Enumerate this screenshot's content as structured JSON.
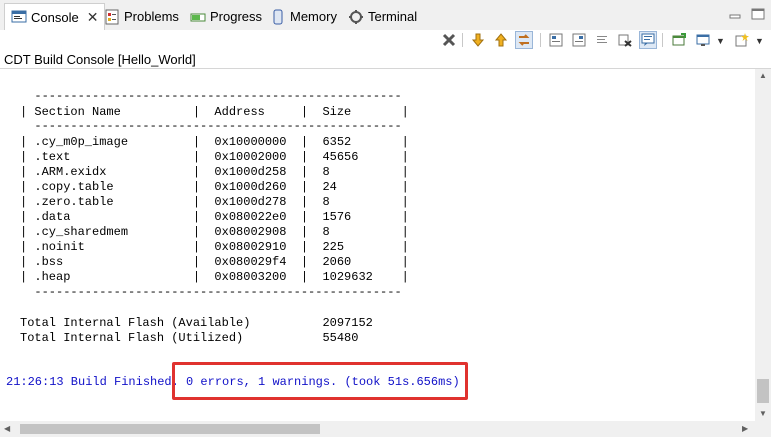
{
  "tabs": [
    {
      "label": "Console",
      "active": true,
      "icon": "console-icon"
    },
    {
      "label": "Problems",
      "active": false,
      "icon": "problems-icon"
    },
    {
      "label": "Progress",
      "active": false,
      "icon": "progress-icon"
    },
    {
      "label": "Memory",
      "active": false,
      "icon": "memory-icon"
    },
    {
      "label": "Terminal",
      "active": false,
      "icon": "terminal-icon"
    }
  ],
  "close_glyph": "✕",
  "console_title": "CDT Build Console [Hello_World]",
  "table": {
    "rule": "  ---------------------------------------------------",
    "header": "| Section Name          |  Address     |  Size       |",
    "rows": [
      "| .cy_m0p_image         |  0x10000000  |  6352       |",
      "| .text                 |  0x10002000  |  45656      |",
      "| .ARM.exidx            |  0x1000d258  |  8          |",
      "| .copy.table           |  0x1000d260  |  24         |",
      "| .zero.table           |  0x1000d278  |  8          |",
      "| .data                 |  0x080022e0  |  1576       |",
      "| .cy_sharedmem         |  0x08002908  |  8          |",
      "| .noinit               |  0x08002910  |  225        |",
      "| .bss                  |  0x080029f4  |  2060       |",
      "| .heap                 |  0x08003200  |  1029632    |"
    ]
  },
  "totals": [
    "Total Internal Flash (Available)          2097152",
    "Total Internal Flash (Utilized)           55480"
  ],
  "build_finished": "21:26:13 Build Finished. 0 errors, 1 warnings. (took 51s.656ms)",
  "colors": {
    "finish_text": "#1010c8",
    "highlight_border": "#e0322f"
  }
}
